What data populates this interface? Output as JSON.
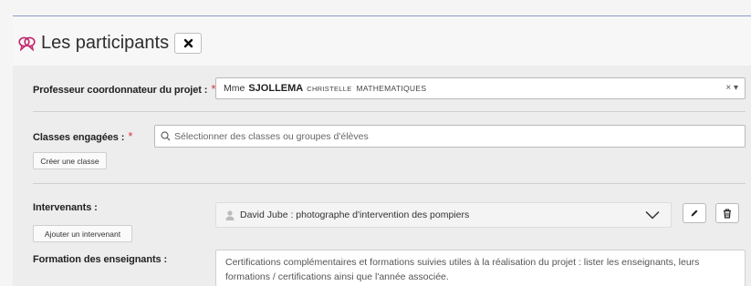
{
  "section": {
    "title": "Les participants",
    "icon": "speech-bubbles-icon",
    "close_icon": "close-icon"
  },
  "coordinateur": {
    "label": "Professeur coordonnateur du projet :",
    "required": "*",
    "civilite": "Mme",
    "nom": "SJOLLEMA",
    "prenom": "CHRISTELLE",
    "matiere": "MATHEMATIQUES",
    "controls": "× ▾"
  },
  "classes": {
    "label": "Classes engagées :",
    "required": "*",
    "placeholder": "Sélectionner des classes ou groupes d'élèves",
    "create_button": "Créer une classe"
  },
  "intervenants": {
    "label": "Intervenants :",
    "add_button": "Ajouter un intervenant",
    "selected": "David Jube : photographe d'intervention des pompiers",
    "edit_icon": "pencil-icon",
    "delete_icon": "trash-icon"
  },
  "formation": {
    "label": "Formation des enseignants :",
    "text": "Certifications complémentaires et formations suivies utiles à la réalisation du projet : lister les enseignants, leurs formations / certifications ainsi que l'année associée."
  },
  "colors": {
    "accent": "#c0266a",
    "required": "#d7373f",
    "topline": "#8e97c9"
  }
}
